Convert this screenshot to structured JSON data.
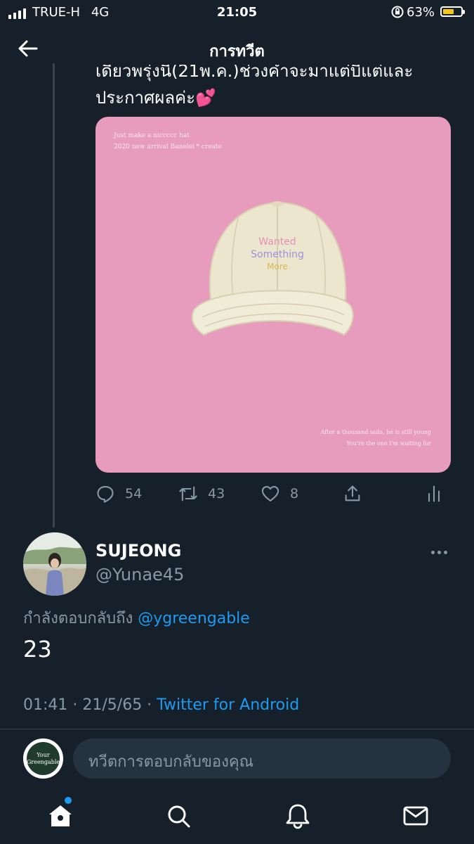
{
  "status_bar": {
    "carrier": "TRUE-H",
    "network": "4G",
    "time": "21:05",
    "battery": "63%",
    "battery_level": 0.63,
    "battery_color": "#f5c518"
  },
  "header": {
    "title": "การทวีต",
    "back_icon": "arrow-left-icon"
  },
  "parent_tweet": {
    "text_line1": "เดียวพรุ่งนี้(21พ.ค.)ช่วงค่ำจะมาแต่บีแต่และ",
    "text_line2": "ประกาศผลค่ะ💕",
    "image": {
      "caption_top1": "Just make a niccccc hat",
      "caption_top2": "2020 new arrival Banelei * create",
      "cap_text1": "Wanted",
      "cap_text2": "Something",
      "cap_text3": "More",
      "caption_bottom1": "After a thousand sails, he is still young",
      "caption_bottom2": "You're the one I'm waiting for",
      "background_color": "#e89cbd"
    },
    "actions": {
      "replies": "54",
      "retweets": "43",
      "likes": "8"
    }
  },
  "reply": {
    "name": "SUJEONG",
    "handle": "@Yunae45",
    "replying_prefix": "กำลังตอบกลับถึง",
    "replying_to": "@ygreengable",
    "text": "23",
    "timestamp": "01:41 · 21/5/65 · ",
    "source": "Twitter for Android"
  },
  "composer": {
    "avatar_text1": "Your",
    "avatar_text2": "Greengable",
    "placeholder": "ทวีตการตอบกลับของคุณ"
  },
  "tab_bar": {
    "items": [
      "home-icon",
      "search-icon",
      "notifications-icon",
      "messages-icon"
    ],
    "accent": "#1d9bf0"
  }
}
